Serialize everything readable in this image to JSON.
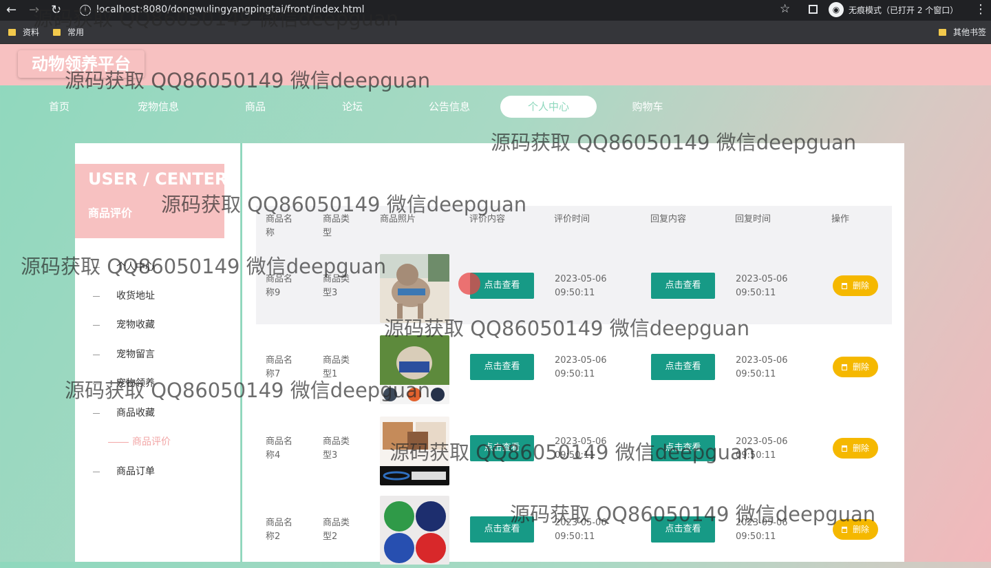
{
  "browser": {
    "url": "localhost:8080/dongwulingyangpingtai/front/index.html",
    "incognito_label": "无痕模式（已打开 2 个窗口）",
    "bookmarks": [
      "资料",
      "常用"
    ],
    "other_bookmarks": "其他书签"
  },
  "site": {
    "logo": "动物领养平台",
    "nav": [
      "首页",
      "宠物信息",
      "商品",
      "论坛",
      "公告信息",
      "个人中心",
      "购物车"
    ],
    "active_nav": "个人中心"
  },
  "sidebar": {
    "title": "USER / CENTER",
    "subtitle": "商品评价",
    "items": [
      "个人中心",
      "收货地址",
      "宠物收藏",
      "宠物留言",
      "宠物领养",
      "商品收藏",
      "商品评价",
      "商品订单"
    ],
    "active_item": "商品评价"
  },
  "table": {
    "headers": {
      "name": "商品名称",
      "type": "商品类型",
      "photo": "商品照片",
      "content": "评价内容",
      "time": "评价时间",
      "reply": "回复内容",
      "reply_time": "回复时间",
      "action": "操作"
    },
    "view_label": "点击查看",
    "delete_label": "删除",
    "rows": [
      {
        "name": "商品名称9",
        "type": "商品类型3",
        "time": "2023-05-06 09:50:11",
        "reply_time": "2023-05-06 09:50:11"
      },
      {
        "name": "商品名称7",
        "type": "商品类型1",
        "time": "2023-05-06 09:50:11",
        "reply_time": "2023-05-06 09:50:11"
      },
      {
        "name": "商品名称4",
        "type": "商品类型3",
        "time": "2023-05-06 09:50:11",
        "reply_time": "2023-05-06 09:50:11"
      },
      {
        "name": "商品名称2",
        "type": "商品类型2",
        "time": "2023-05-06 09:50:11",
        "reply_time": "2023-05-06 09:50:11"
      }
    ]
  },
  "watermark": "源码获取 QQ86050149 微信deepguan",
  "colors": {
    "header_pink": "#f7c1c1",
    "nav_green": "#8ed8bd",
    "button_teal": "#179a86",
    "delete_yellow": "#f5b800"
  }
}
